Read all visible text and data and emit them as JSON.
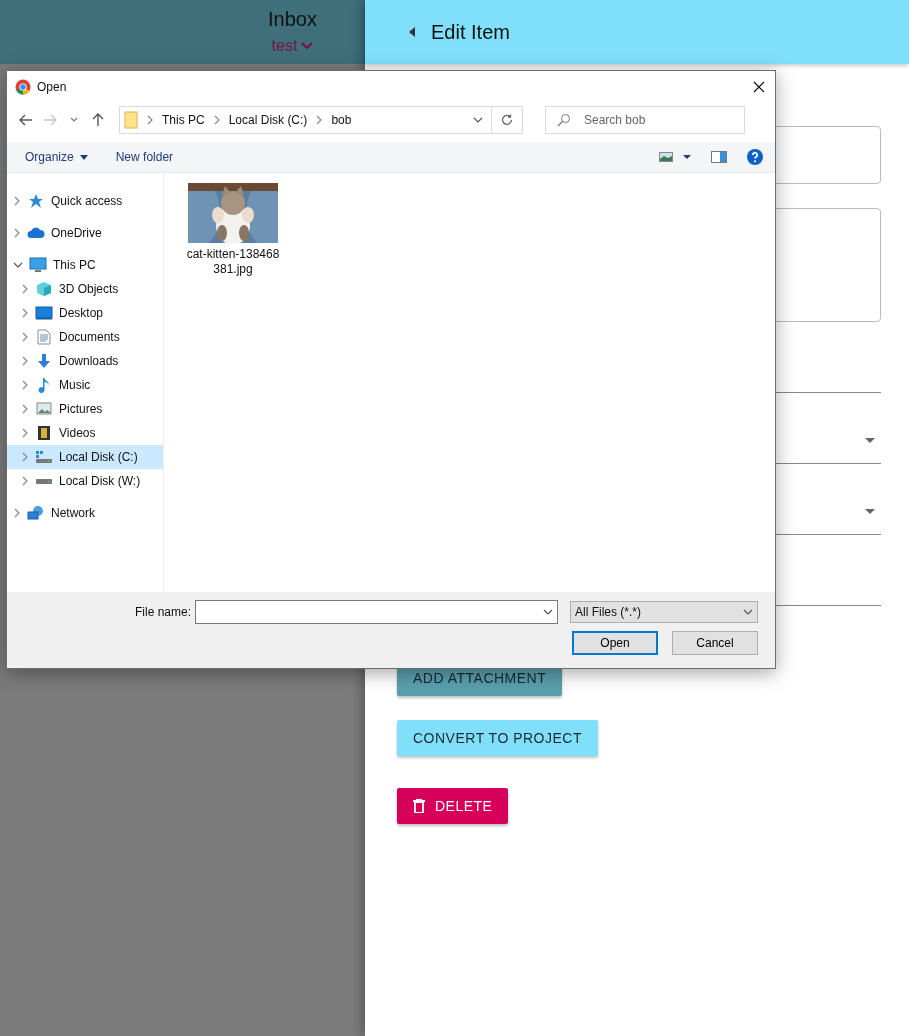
{
  "app_header": {
    "title": "Inbox",
    "subtitle": "test"
  },
  "panel": {
    "title": "Edit Item",
    "fields": [
      {
        "kind": "outlined"
      },
      {
        "kind": "textarea"
      },
      {
        "kind": "line"
      },
      {
        "kind": "select"
      },
      {
        "kind": "select"
      },
      {
        "kind": "line"
      }
    ],
    "buttons": [
      {
        "label": "ADD ATTACHMENT",
        "kind": "primary"
      },
      {
        "label": "CONVERT TO PROJECT",
        "kind": "secondary"
      },
      {
        "label": "DELETE",
        "kind": "danger"
      }
    ]
  },
  "dialog": {
    "title": "Open",
    "path": [
      "This PC",
      "Local Disk (C:)",
      "bob"
    ],
    "search": {
      "placeholder": "Search bob"
    },
    "toolbar": [
      {
        "label": "Organize",
        "kind": "menu"
      },
      {
        "label": "New folder",
        "kind": "button"
      }
    ],
    "nav": [
      {
        "label": "Quick access",
        "kind": "star",
        "expanded": false,
        "selected": false
      },
      {
        "label": "OneDrive",
        "kind": "cloud",
        "expanded": false,
        "selected": false
      },
      {
        "label": "This PC",
        "kind": "computer",
        "expanded": true,
        "selected": false,
        "children": [
          {
            "label": "3D Objects",
            "kind": "cube",
            "expanded": false,
            "selected": false
          },
          {
            "label": "Desktop",
            "kind": "desktop",
            "expanded": false,
            "selected": false
          },
          {
            "label": "Documents",
            "kind": "documents",
            "expanded": false,
            "selected": false
          },
          {
            "label": "Downloads",
            "kind": "downloads",
            "expanded": false,
            "selected": false
          },
          {
            "label": "Music",
            "kind": "music",
            "expanded": false,
            "selected": false
          },
          {
            "label": "Pictures",
            "kind": "pictures",
            "expanded": false,
            "selected": false
          },
          {
            "label": "Videos",
            "kind": "videos",
            "expanded": false,
            "selected": false
          },
          {
            "label": "Local Disk (C:)",
            "kind": "system-drive",
            "expanded": false,
            "selected": true
          },
          {
            "label": "Local Disk (W:)",
            "kind": "drive",
            "expanded": false,
            "selected": false
          }
        ]
      },
      {
        "label": "Network",
        "kind": "network",
        "expanded": false,
        "selected": false
      }
    ],
    "files": [
      {
        "name": "cat-kitten-138468381.jpg",
        "kind": "picture"
      }
    ],
    "file_name": {
      "label": "File name:"
    },
    "filter": "All Files (*.*)",
    "buttons": [
      {
        "label": "Open",
        "focused": true
      },
      {
        "label": "Cancel",
        "focused": false
      }
    ]
  }
}
